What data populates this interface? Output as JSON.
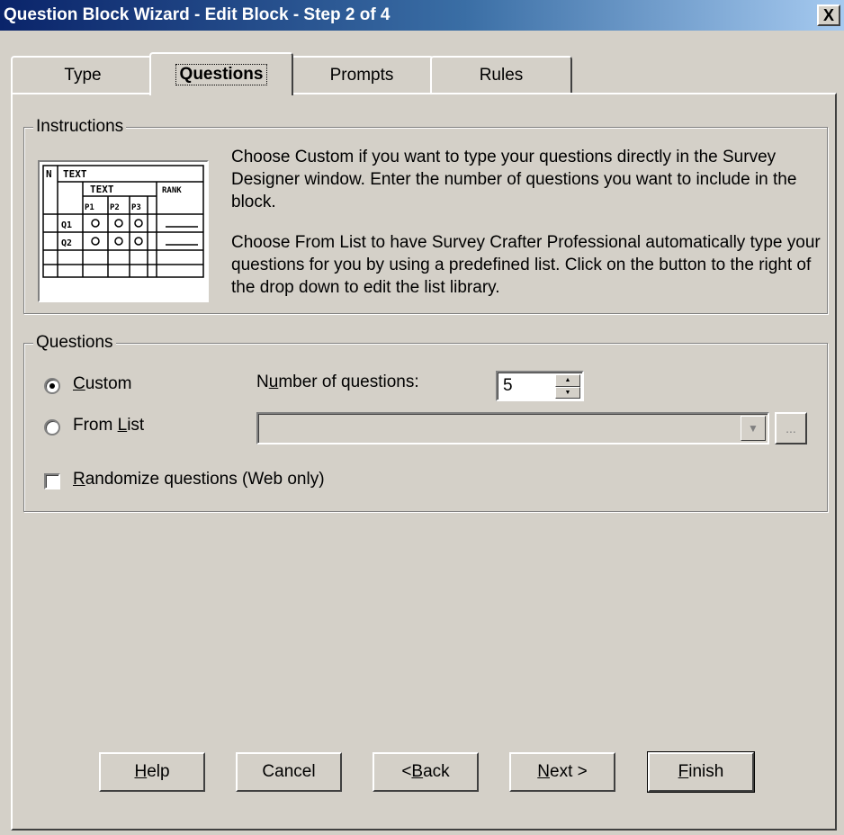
{
  "window": {
    "title": "Question Block Wizard - Edit Block - Step 2 of 4",
    "close_label": "X"
  },
  "tabs": [
    {
      "label": "Type",
      "active": false
    },
    {
      "label": "Questions",
      "active": true
    },
    {
      "label": "Prompts",
      "active": false
    },
    {
      "label": "Rules",
      "active": false
    }
  ],
  "instructions": {
    "legend": "Instructions",
    "paragraph1": "Choose Custom if you want to type your questions directly in the Survey Designer window. Enter the number of questions you want to include in the block.",
    "paragraph2": "Choose From List to have Survey Crafter Professional automatically type your questions for you by using a predefined list. Click on the button to the right of the drop down to edit the list library.",
    "thumbnail": {
      "n": "N",
      "text_header": "TEXT",
      "text_sub": "TEXT",
      "rank": "RANK",
      "p1": "P1",
      "p2": "P2",
      "p3": "P3",
      "q1": "Q1",
      "q2": "Q2"
    }
  },
  "questions": {
    "legend": "Questions",
    "custom_label": "Custom",
    "custom_accel": "C",
    "custom_rest": "ustom",
    "custom_selected": true,
    "from_list_label": "From List",
    "from_list_pre": "From ",
    "from_list_accel": "L",
    "from_list_rest": "ist",
    "from_list_selected": false,
    "num_questions_label": "Number of questions:",
    "num_pre": "N",
    "num_accel": "u",
    "num_rest": "mber of questions:",
    "num_questions_value": "5",
    "list_value": "",
    "dots_label": "...",
    "randomize_label": "Randomize questions (Web only)",
    "rand_accel": "R",
    "rand_rest": "andomize questions (Web only)",
    "randomize_checked": false
  },
  "buttons": {
    "help": {
      "label": "Help",
      "accel": "H",
      "rest": "elp"
    },
    "cancel": {
      "label": "Cancel"
    },
    "back": {
      "label": "< Back",
      "pre": "< ",
      "accel": "B",
      "rest": "ack"
    },
    "next": {
      "label": "Next >",
      "accel": "N",
      "rest": "ext >"
    },
    "finish": {
      "label": "Finish",
      "accel": "F",
      "rest": "inish"
    }
  }
}
